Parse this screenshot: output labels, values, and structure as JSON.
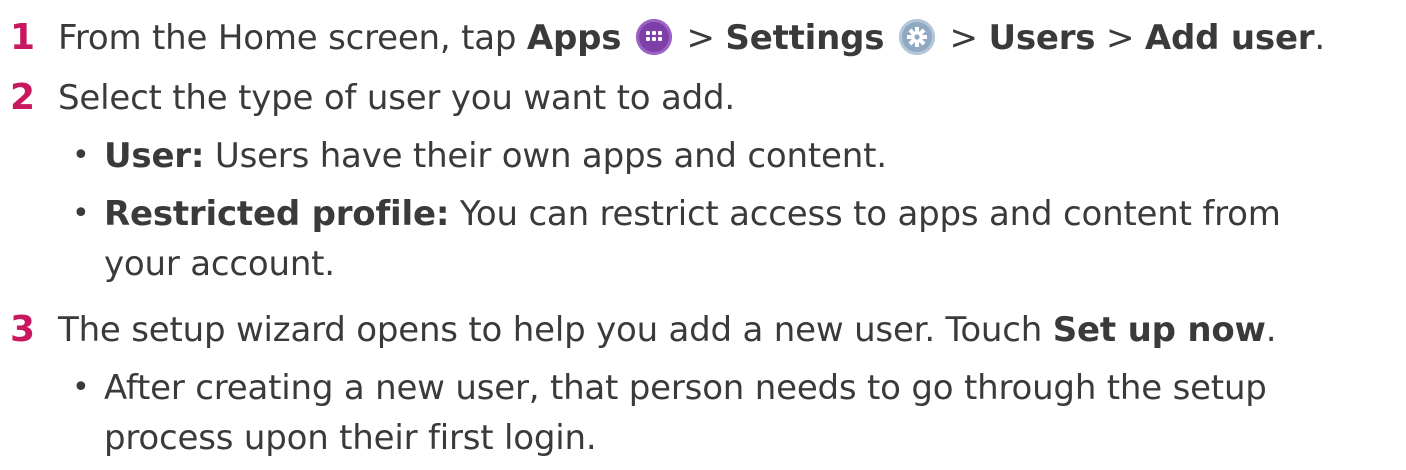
{
  "steps": [
    {
      "number": "1",
      "parts": {
        "t1": "From the Home screen, tap ",
        "apps": "Apps",
        "sep1": " > ",
        "settings": "Settings",
        "sep2": " > ",
        "users": "Users",
        "sep3": " > ",
        "add_user": "Add user",
        "end": "."
      },
      "icons": [
        "apps-icon",
        "settings-icon"
      ]
    },
    {
      "number": "2",
      "text": "Select the type of user you want to add.",
      "bullets": [
        {
          "bold": "User:",
          "text": " Users have their own apps and content."
        },
        {
          "bold": "Restricted profile:",
          "text": " You can restrict access to apps and content from",
          "text_cont": "your account."
        }
      ]
    },
    {
      "number": "3",
      "text": "The setup wizard opens to help you add a new user. Touch ",
      "bold": "Set up now",
      "end": ".",
      "bullets": [
        {
          "text": "After creating a new user, that person needs to go through the setup",
          "text_cont": "process upon their first login."
        }
      ]
    }
  ],
  "bullet_char": "•",
  "colors": {
    "step_number": "#c8185f",
    "text": "#3a3a3a",
    "apps_icon": "#7d3fa8",
    "settings_icon": "#8fa9c2"
  }
}
